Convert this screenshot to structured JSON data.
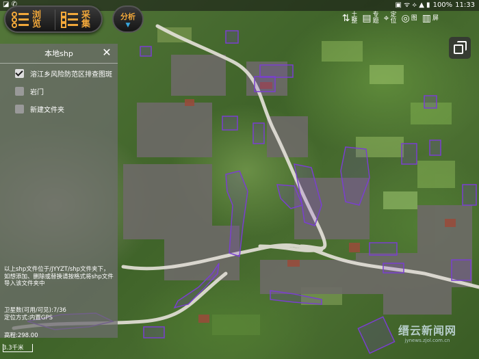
{
  "statusbar": {
    "left_icons": "◪ ✆",
    "icons": "▣ ᯤ ⟡ ▲ ▮",
    "battery": "100%",
    "time": "11:33"
  },
  "toolbar": {
    "browse_label": "浏览",
    "collect_label": "采集",
    "analyze_label": "分析",
    "analyze_arrow": "▼",
    "right_items": [
      {
        "glyph": "⇅",
        "label": "土整"
      },
      {
        "glyph": "▤",
        "label": "专题"
      },
      {
        "glyph": "⌖",
        "label": "定位"
      },
      {
        "glyph": "◎",
        "label": "图"
      },
      {
        "glyph": "▥",
        "label": "屏"
      }
    ]
  },
  "panel": {
    "title": "本地shp",
    "close": "✕",
    "items": [
      {
        "label": "溶江乡风险防范区排查图斑",
        "checked": true
      },
      {
        "label": "岩门",
        "checked": false
      },
      {
        "label": "新建文件夹",
        "checked": false
      }
    ],
    "note": "以上shp文件位于/JYYZT/shp文件夹下，如想添加、删除或替换请按格式将shp文件导入该文件夹中",
    "satellites": "卫星数(可用/可见):7/36",
    "positioning": "定位方式:内置GPS"
  },
  "map": {
    "altitude": "高程:298.00",
    "scale": "3.3千米",
    "colors": {
      "polygon": "#7a3fd0",
      "road": "#e6e2da"
    }
  },
  "watermark": {
    "title": "缙云新闻网",
    "url": "jynews.zjol.com.cn"
  }
}
